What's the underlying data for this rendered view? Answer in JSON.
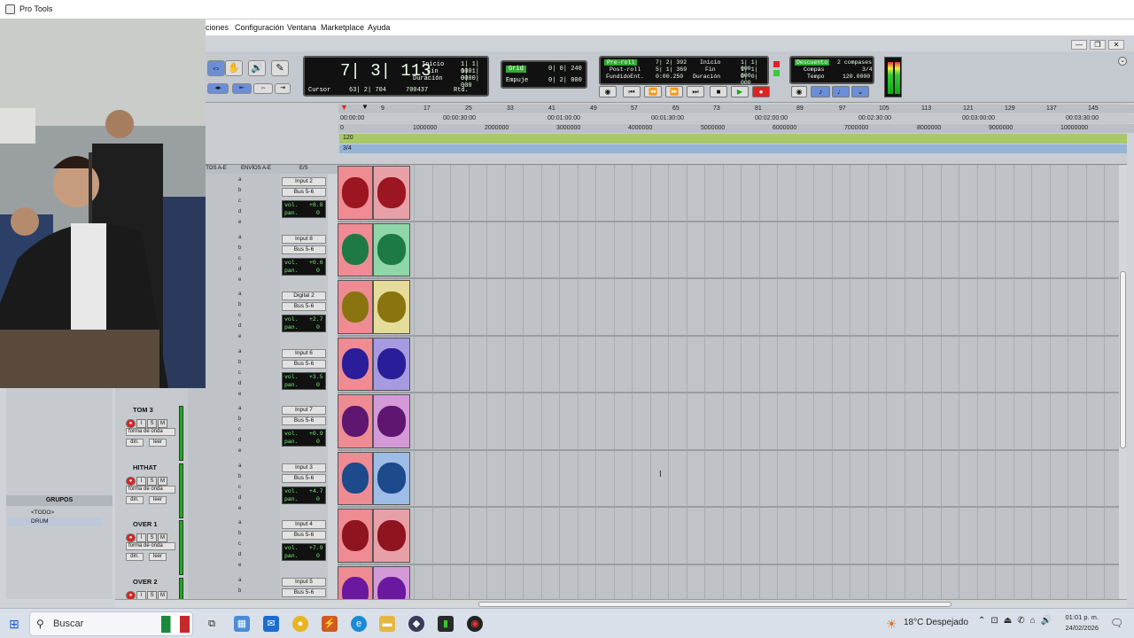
{
  "window": {
    "title": "Pro Tools"
  },
  "menu": [
    "ciones",
    "Configuración",
    "Ventana",
    "Marketplace",
    "Ayuda"
  ],
  "counters": {
    "main": "7| 3| 113",
    "cursor_label": "Cursor",
    "cursor_value": "63| 2| 704",
    "cursor_sample": "700437",
    "inicio_label": "Inicio",
    "inicio_value": "1| 1| 000",
    "fin_label": "Fin",
    "fin_value": "1| 1| 000",
    "duracion_label": "Duración",
    "duracion_value": "0| 0| 000",
    "rtd": "Rtd."
  },
  "grid": {
    "grid_label": "Grid",
    "grid_value": "0| 0| 240",
    "empuje_label": "Empuje",
    "empuje_value": "0| 2| 000"
  },
  "transport": {
    "preroll_label": "Pre-roll",
    "preroll_value": "7| 2| 392",
    "postroll_label": "Post-roll",
    "postroll_value": "5| 1| 369",
    "fundido_label": "FundidoEnt.",
    "fundido_value": "0:00.250",
    "inicio_label": "Inicio",
    "inicio_value": "1| 1| 000",
    "fin_label": "Fin",
    "fin_value": "1| 1| 000",
    "duracion_label": "Duración",
    "duracion_value": "0| 0| 000"
  },
  "countoff": {
    "countoff_label": "Descuento",
    "countoff_value": "2 compases",
    "compas_label": "Compás",
    "compas_value": "3/4",
    "tempo_label": "Tempo",
    "tempo_value": "120.0000"
  },
  "ruler": {
    "bars": [
      "9",
      "17",
      "25",
      "33",
      "41",
      "49",
      "57",
      "65",
      "73",
      "81",
      "89",
      "97",
      "105",
      "113",
      "121",
      "129",
      "137",
      "145"
    ],
    "minsecs": [
      "00:00:00",
      "00:00:30:00",
      "00:01:00:00",
      "00:01:30:00",
      "00:02:00:00",
      "00:02:30:00",
      "00:03:00:00",
      "00:03:30:00"
    ],
    "samples": [
      "0",
      "1000000",
      "2000000",
      "3000000",
      "4000000",
      "5000000",
      "6000000",
      "7000000",
      "8000000",
      "9000000",
      "10000000"
    ],
    "tempo": "120",
    "meter": "3/4"
  },
  "mix_headers": {
    "inserts": "RTOS A-E",
    "sends": "ENVÍOS A-E",
    "io": "E/S"
  },
  "tracks": [
    {
      "input": "Input 2",
      "output": "Bus 5-6",
      "vol": "+8.8",
      "pan": "0",
      "color": "#e8a0a8",
      "wave": "#9b1620"
    },
    {
      "input": "Input 8",
      "output": "Bus 5-6",
      "vol": "+0.6",
      "pan": "0",
      "color": "#8fd6a8",
      "wave": "#1e7a45"
    },
    {
      "input": "Digital 2",
      "output": "Bus 5-6",
      "vol": "+2.7",
      "pan": "0",
      "color": "#e6dc9a",
      "wave": "#8a7410"
    },
    {
      "input": "Input 6",
      "output": "Bus 5-6",
      "vol": "+3.5",
      "pan": "0",
      "color": "#a79ae0",
      "wave": "#2a1d9a"
    },
    {
      "name": "TOM 3",
      "input": "Input 7",
      "output": "Bus 5-6",
      "vol": "+0.9",
      "pan": "0",
      "color": "#d49ad8",
      "wave": "#5e1670"
    },
    {
      "name": "HITHAT",
      "input": "Input 3",
      "output": "Bus 5-6",
      "vol": "+4.7",
      "pan": "0",
      "color": "#9ebde6",
      "wave": "#1c4a8a"
    },
    {
      "name": "OVER 1",
      "input": "Input 4",
      "output": "Bus 5-6",
      "vol": "+7.9",
      "pan": "0",
      "color": "#e8a0a8",
      "wave": "#8e1420"
    },
    {
      "name": "OVER 2",
      "input": "Input 5",
      "output": "Bus 5-6",
      "color": "#d49ad8",
      "wave": "#6a18a0"
    }
  ],
  "track_labels": {
    "vol": "vol.",
    "pan": "pan.",
    "view": "forma de onda",
    "dyn": "din.",
    "read": "leer",
    "sends": [
      "a",
      "b",
      "c",
      "d",
      "e"
    ]
  },
  "groups": {
    "title": "GRUPOS",
    "items": [
      "<TODO>",
      "DRUM"
    ]
  },
  "taskbar": {
    "search_placeholder": "Buscar",
    "weather": "18°C  Despejado",
    "time": "01:01 p. m.",
    "date": "24/02/2026"
  }
}
